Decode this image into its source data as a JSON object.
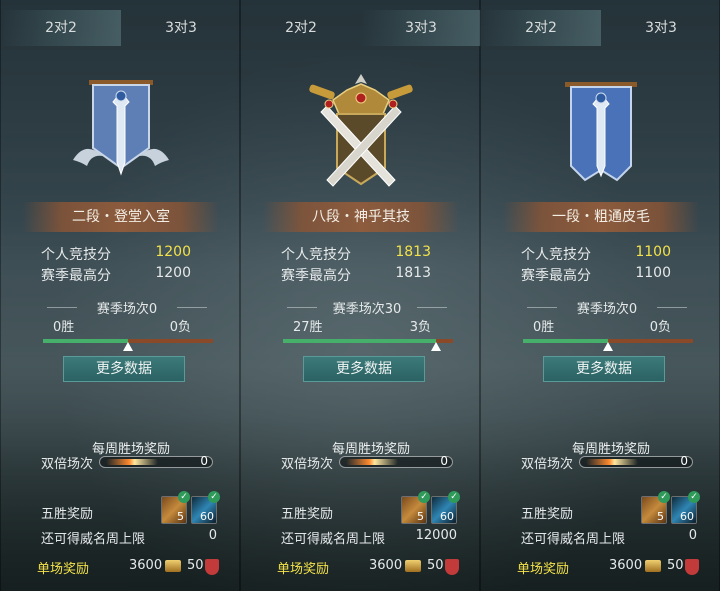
{
  "tabs": [
    "2对2",
    "3对3"
  ],
  "labels": {
    "personal_score": "个人竞技分",
    "season_high": "赛季最高分",
    "more_data": "更多数据",
    "weekly_title": "每周胜场奖励",
    "double_matches": "双倍场次",
    "five_win_reward": "五胜奖励",
    "renown_cap": "还可得威名周上限",
    "single_reward": "单场奖励"
  },
  "panels": [
    {
      "active_tab": 0,
      "emblem": "silver-banner-sword-icon",
      "rank": "二段・登堂入室",
      "score": "1200",
      "season_high": "1200",
      "season_matches": "赛季场次0",
      "wins": "0胜",
      "losses": "0负",
      "win_ratio": 0.5,
      "double_count": "0",
      "item_a_count": "5",
      "item_b_count": "60",
      "renown_cap": "0",
      "single_coin": "3600",
      "single_honor": "50"
    },
    {
      "active_tab": 1,
      "emblem": "gold-crossed-swords-crown-icon",
      "rank": "八段・神乎其技",
      "score": "1813",
      "season_high": "1813",
      "season_matches": "赛季场次30",
      "wins": "27胜",
      "losses": "3负",
      "win_ratio": 0.9,
      "double_count": "0",
      "item_a_count": "5",
      "item_b_count": "60",
      "renown_cap": "12000",
      "single_coin": "3600",
      "single_honor": "50"
    },
    {
      "active_tab": 0,
      "emblem": "blue-banner-sword-icon",
      "rank": "一段・粗通皮毛",
      "score": "1100",
      "season_high": "1100",
      "season_matches": "赛季场次0",
      "wins": "0胜",
      "losses": "0负",
      "win_ratio": 0.5,
      "double_count": "0",
      "item_a_count": "5",
      "item_b_count": "60",
      "renown_cap": "0",
      "single_coin": "3600",
      "single_honor": "50"
    }
  ],
  "colors": {
    "highlight_score": "#f3e24a",
    "win_bar": "#46b06a",
    "loss_bar": "#8a4a2a",
    "button": "#2b6263"
  }
}
